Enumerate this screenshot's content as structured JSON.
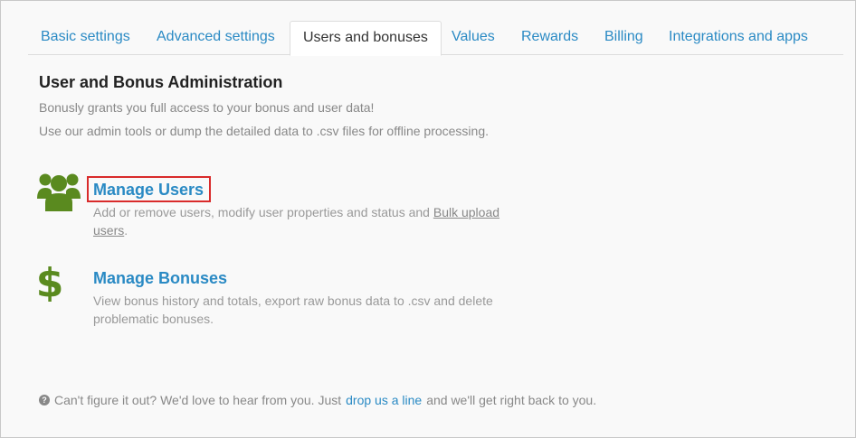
{
  "colors": {
    "accent": "#2a8ac4",
    "icon_green": "#5a8a1f",
    "highlight_red": "#d92b2b",
    "muted_text": "#888888"
  },
  "tabs": [
    {
      "label": "Basic settings",
      "active": false
    },
    {
      "label": "Advanced settings",
      "active": false
    },
    {
      "label": "Users and bonuses",
      "active": true
    },
    {
      "label": "Values",
      "active": false
    },
    {
      "label": "Rewards",
      "active": false
    },
    {
      "label": "Billing",
      "active": false
    },
    {
      "label": "Integrations and apps",
      "active": false
    }
  ],
  "main": {
    "title": "User and Bonus Administration",
    "intro_line1": "Bonusly grants you full access to your bonus and user data!",
    "intro_line2": "Use our admin tools or dump the detailed data to .csv files for offline processing."
  },
  "manage_users": {
    "icon": "users-group-icon",
    "title": "Manage Users",
    "desc_text": "Add or remove users, modify user properties and status and ",
    "link_text": "Bulk upload users",
    "desc_end": "."
  },
  "manage_bonuses": {
    "icon": "dollar-sign-icon",
    "title": "Manage Bonuses",
    "desc_text": "View bonus history and totals, export raw bonus data to .csv and delete problematic bonuses."
  },
  "footer": {
    "icon": "question-circle-icon",
    "question_glyph": "?",
    "text_before": "Can't figure it out? We'd love to hear from you. Just",
    "link_text": "drop us a line",
    "text_after": "and we'll get right back to you."
  }
}
